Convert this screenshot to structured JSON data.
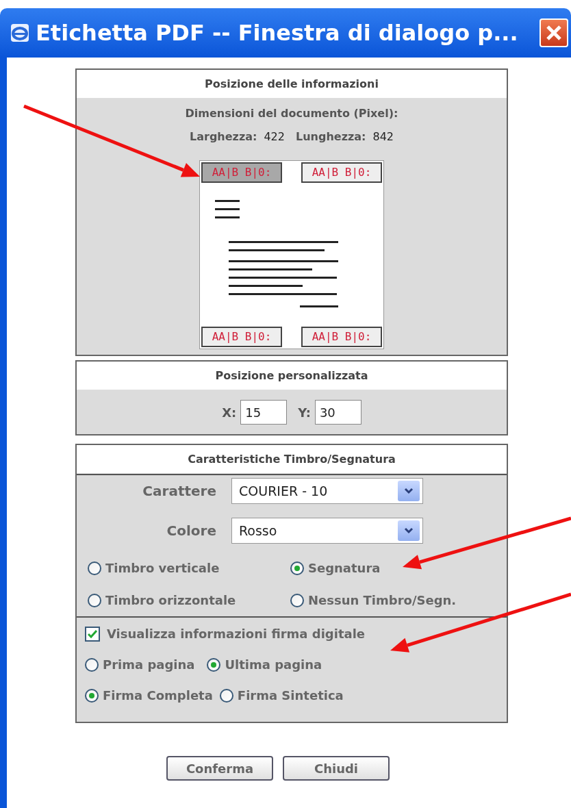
{
  "window": {
    "title": "Etichetta PDF -- Finestra di dialogo p..."
  },
  "info_panel": {
    "header": "Posizione delle informazioni",
    "dimensions_label": "Dimensioni del documento (Pixel):",
    "width_label": "Larghezza:",
    "width_value": "422",
    "height_label": "Lunghezza:",
    "height_value": "842",
    "stamps": [
      {
        "text": "AA|B B|0:",
        "selected": true
      },
      {
        "text": "AA|B B|0:",
        "selected": false
      },
      {
        "text": "AA|B B|0:",
        "selected": false
      },
      {
        "text": "AA|B B|0:",
        "selected": false
      }
    ]
  },
  "custom_panel": {
    "header": "Posizione personalizzata",
    "x_label": "X:",
    "x_value": "15",
    "y_label": "Y:",
    "y_value": "30"
  },
  "stamp_panel": {
    "header": "Caratteristiche Timbro/Segnatura",
    "fields": [
      {
        "label": "Carattere",
        "value": "COURIER - 10"
      },
      {
        "label": "Colore",
        "value": "Rosso"
      }
    ],
    "stamp_types": [
      {
        "label": "Timbro verticale",
        "selected": false
      },
      {
        "label": "Segnatura",
        "selected": true
      },
      {
        "label": "Timbro orizzontale",
        "selected": false
      },
      {
        "label": "Nessun Timbro/Segn.",
        "selected": false
      }
    ],
    "signature": {
      "label": "Visualizza informazioni firma digitale",
      "checked": true
    },
    "pages": [
      {
        "label": "Prima pagina",
        "selected": false
      },
      {
        "label": "Ultima pagina",
        "selected": true
      }
    ],
    "signature_types": [
      {
        "label": "Firma Completa",
        "selected": true
      },
      {
        "label": "Firma Sintetica",
        "selected": false
      }
    ]
  },
  "buttons": [
    "Conferma",
    "Chiudi"
  ]
}
